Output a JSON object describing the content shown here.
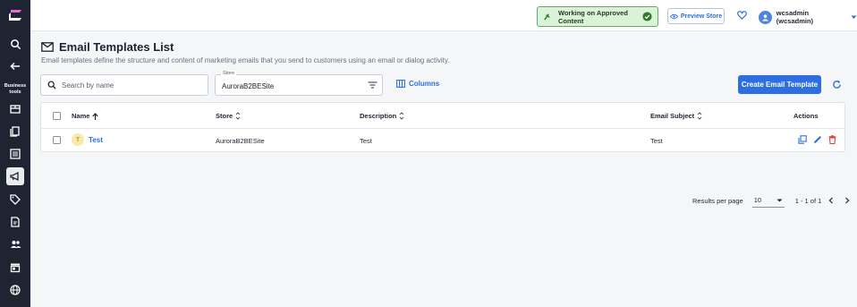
{
  "rail": {
    "items": [
      {
        "name": "search-icon",
        "label": ""
      },
      {
        "name": "back-arrow-icon",
        "label": ""
      },
      {
        "name": "business-tools",
        "label": "Business tools"
      }
    ],
    "business_tools_label_line1": "Business",
    "business_tools_label_line2": "tools"
  },
  "topbar": {
    "approved_label": "Working on Approved Content",
    "preview_label": "Preview Store",
    "user_label": "wcsadmin (wcsadmin)"
  },
  "page": {
    "title": "Email Templates List",
    "description": "Email templates define the structure and content of marketing emails that you send to customers using an email or dialog activity."
  },
  "toolbar": {
    "search_placeholder": "Search by name",
    "store_label": "Store",
    "store_value": "AuroraB2BESite",
    "columns_label": "Columns",
    "create_label": "Create Email Template"
  },
  "table": {
    "headers": {
      "name": "Name",
      "store": "Store",
      "description": "Description",
      "email_subject": "Email Subject",
      "actions": "Actions"
    },
    "rows": [
      {
        "initial": "T",
        "name": "Test",
        "store": "AuroraB2BESite",
        "description": "Test",
        "email_subject": "Test"
      }
    ]
  },
  "pagination": {
    "results_per_page_label": "Results per page",
    "results_per_page_value": "10",
    "range": "1 - 1 of 1"
  },
  "colors": {
    "accent": "#2d6fe0",
    "rail_bg": "#1e2432",
    "approved_bg": "#d9f2d8",
    "delete": "#e0423a"
  }
}
